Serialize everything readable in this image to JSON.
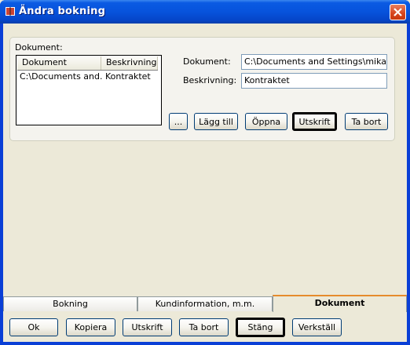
{
  "window": {
    "title": "Ändra bokning"
  },
  "documents": {
    "group_label": "Dokument:",
    "columns": [
      "Dokument",
      "Beskrivning"
    ],
    "rows": [
      {
        "dokument": "C:\\Documents and...",
        "beskrivning": "Kontraktet"
      }
    ],
    "fields": {
      "dokument_label": "Dokument:",
      "dokument_value": "C:\\Documents and Settings\\mikaelt\\",
      "beskrivning_label": "Beskrivning:",
      "beskrivning_value": "Kontraktet"
    },
    "buttons": {
      "browse": "...",
      "add": "Lägg till",
      "open": "Öppna",
      "print": "Utskrift",
      "remove": "Ta bort"
    }
  },
  "tabs": [
    {
      "label": "Bokning",
      "active": false
    },
    {
      "label": "Kundinformation, m.m.",
      "active": false
    },
    {
      "label": "Dokument",
      "active": true
    }
  ],
  "footer": {
    "ok": "Ok",
    "copy": "Kopiera",
    "print": "Utskrift",
    "remove": "Ta bort",
    "close": "Stäng",
    "apply": "Verkställ"
  }
}
